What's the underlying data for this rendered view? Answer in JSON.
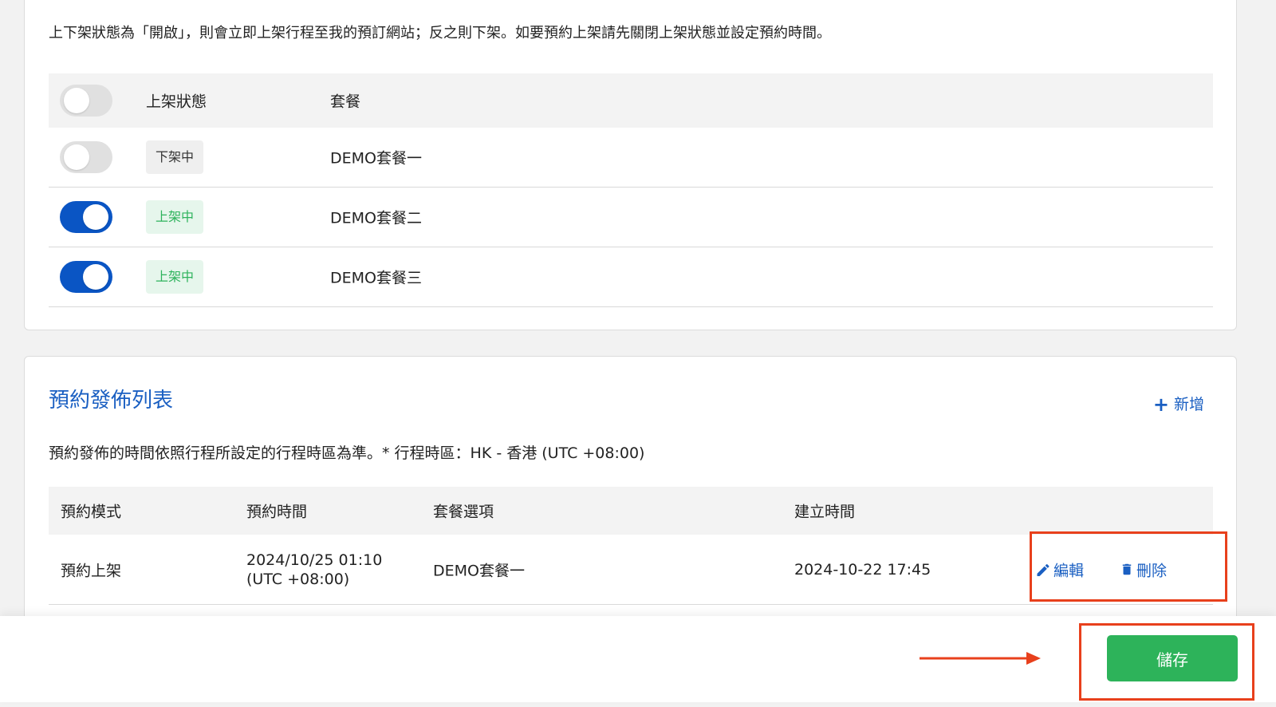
{
  "publish_section": {
    "notice": "上下架狀態為「開啟」，則會立即上架行程至我的預訂網站；反之則下架。如要預約上架請先關閉上架狀態並設定預約時間。",
    "headers": {
      "status": "上架狀態",
      "plan": "套餐"
    },
    "rows": [
      {
        "toggle_on": false,
        "status": "下架中",
        "plan": "DEMO套餐一"
      },
      {
        "toggle_on": true,
        "status": "上架中",
        "plan": "DEMO套餐二"
      },
      {
        "toggle_on": true,
        "status": "上架中",
        "plan": "DEMO套餐三"
      }
    ]
  },
  "schedule_section": {
    "title": "預約發佈列表",
    "add_label": "新增",
    "timezone_note": "預約發佈的時間依照行程所設定的行程時區為準。* 行程時區：HK - 香港 (UTC +08:00)",
    "headers": {
      "mode": "預約模式",
      "time": "預約時間",
      "plan": "套餐選項",
      "created": "建立時間"
    },
    "rows": [
      {
        "mode": "預約上架",
        "time_line1": "2024/10/25 01:10",
        "time_line2": "(UTC +08:00)",
        "plan": "DEMO套餐一",
        "created": "2024-10-22 17:45",
        "edit_label": "編輯",
        "delete_label": "刪除"
      }
    ]
  },
  "footer": {
    "save_label": "儲存"
  },
  "colors": {
    "accent": "#1a5fc2",
    "toggle_on": "#0a55c4",
    "save": "#2db35a",
    "highlight": "#e8401c"
  }
}
